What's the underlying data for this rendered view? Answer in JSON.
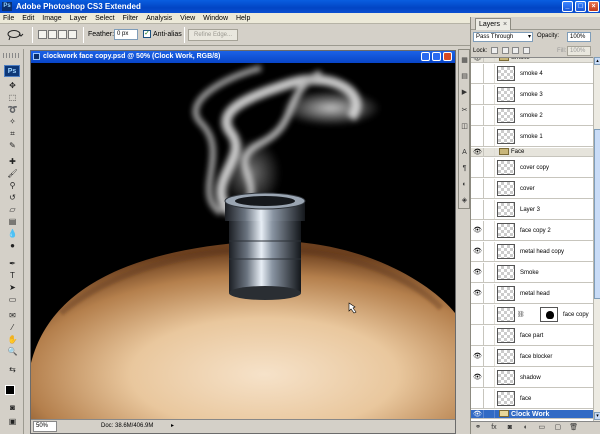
{
  "app": {
    "title": "Adobe Photoshop CS3 Extended",
    "logo": "Ps"
  },
  "menu": [
    "File",
    "Edit",
    "Image",
    "Layer",
    "Select",
    "Filter",
    "Analysis",
    "View",
    "Window",
    "Help"
  ],
  "options": {
    "feather_label": "Feather:",
    "feather_value": "0 px",
    "antialias_label": "Anti-alias",
    "antialias_checked": "✓",
    "refine_edge": "Refine Edge..."
  },
  "document": {
    "title": "clockwork face copy.psd @ 50% (Clock Work, RGB/8)",
    "zoom": "50%",
    "doc_size": "Doc: 38.6M/406.9M"
  },
  "layers_panel": {
    "tab": "Layers",
    "close": "×",
    "blend_mode": "Pass Through",
    "opacity_label": "Opacity:",
    "opacity": "100%",
    "lock_label": "Lock:",
    "fill_label": "Fill:",
    "fill": "100%",
    "rows": [
      {
        "name": "Smoke",
        "type": "group",
        "visible": true
      },
      {
        "name": "smoke 4",
        "type": "layer",
        "visible": false
      },
      {
        "name": "smoke 3",
        "type": "layer",
        "visible": false
      },
      {
        "name": "smoke 2",
        "type": "layer",
        "visible": false
      },
      {
        "name": "smoke 1",
        "type": "layer",
        "visible": false
      },
      {
        "name": "Face",
        "type": "group",
        "visible": true
      },
      {
        "name": "cover copy",
        "type": "layer",
        "visible": false
      },
      {
        "name": "cover",
        "type": "layer",
        "visible": false
      },
      {
        "name": "Layer 3",
        "type": "layer",
        "visible": false
      },
      {
        "name": "face copy 2",
        "type": "layer",
        "visible": true
      },
      {
        "name": "metal head copy",
        "type": "layer",
        "visible": true
      },
      {
        "name": "Smoke",
        "type": "layer",
        "visible": true
      },
      {
        "name": "metal head",
        "type": "layer",
        "visible": true
      },
      {
        "name": "face copy",
        "type": "layer-mask",
        "visible": false
      },
      {
        "name": "face part",
        "type": "layer",
        "visible": false
      },
      {
        "name": "face blocker",
        "type": "layer",
        "visible": true
      },
      {
        "name": "shadow",
        "type": "layer",
        "visible": true
      },
      {
        "name": "face",
        "type": "layer",
        "visible": false
      },
      {
        "name": "Clock Work",
        "type": "group-selected",
        "visible": true
      }
    ]
  },
  "colors": {
    "title_blue": "#0245c4",
    "selection": "#316ac5",
    "panel_gray": "#d4d0c8"
  }
}
